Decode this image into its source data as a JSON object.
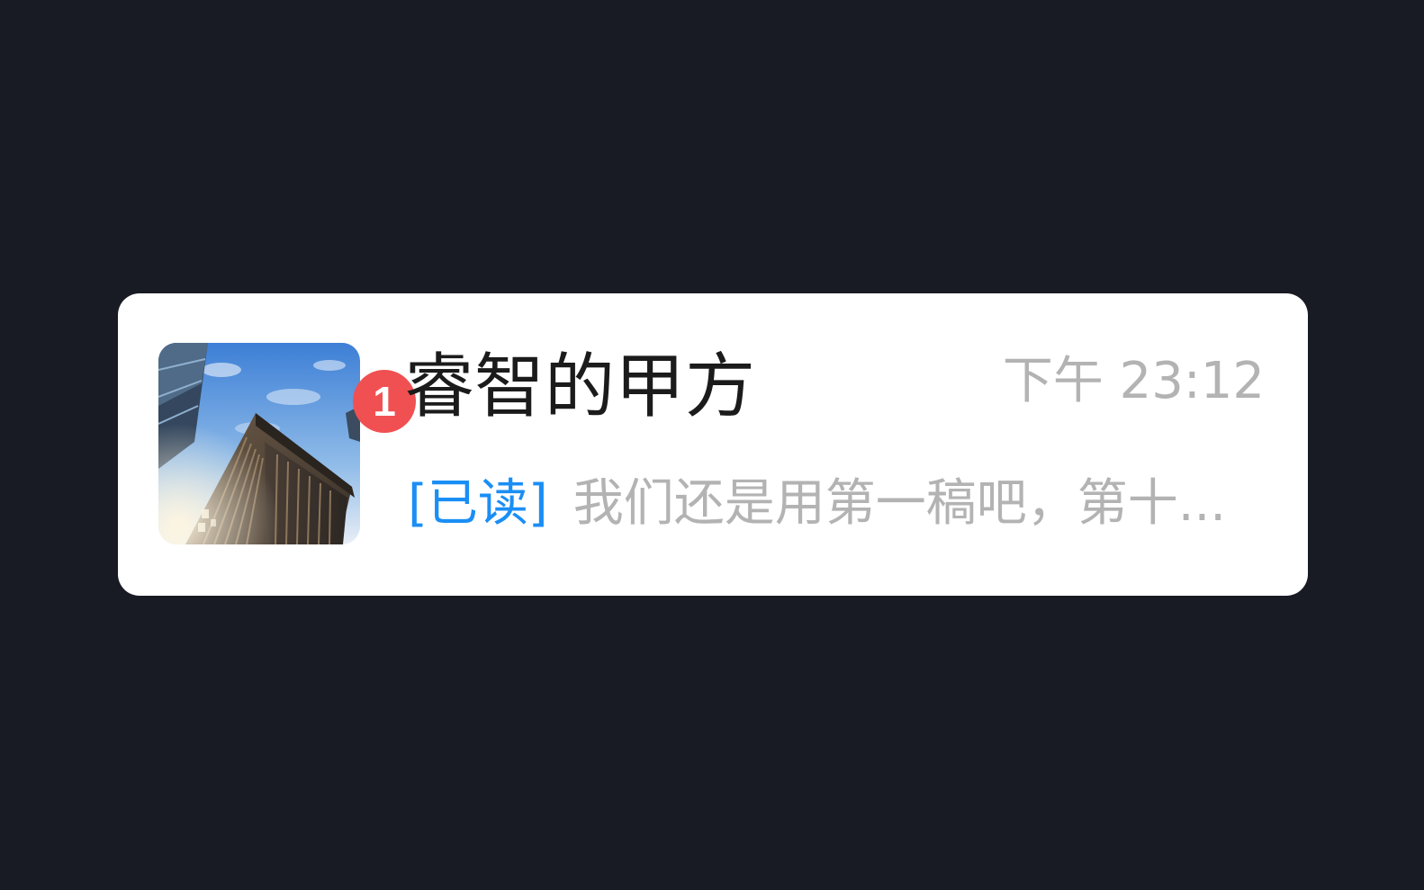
{
  "chat_item": {
    "contact_name": "睿智的甲方",
    "time": "下午 23:12",
    "unread_count": "1",
    "read_status": "[已读]",
    "message_preview": "我们还是用第一稿吧，第十...",
    "avatar_icon": "building-photo-avatar",
    "colors": {
      "background": "#181b24",
      "card": "#ffffff",
      "badge": "#f05052",
      "read_status": "#1a8ef5",
      "secondary_text": "#b3b3b3",
      "name_text": "#1b1b1b"
    }
  }
}
